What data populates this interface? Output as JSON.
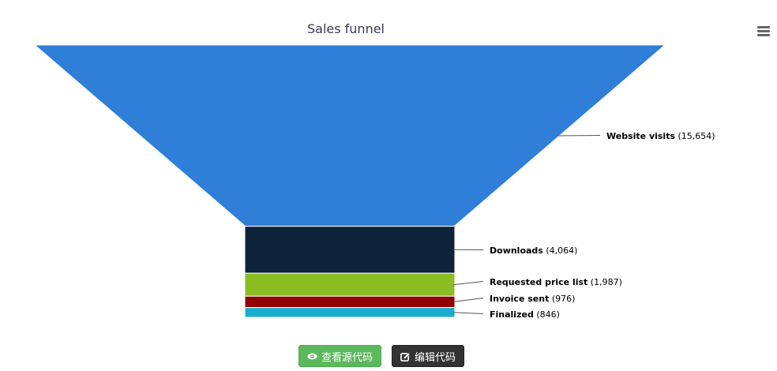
{
  "chart_data": {
    "type": "funnel",
    "title": "Sales funnel",
    "categories": [
      "Website visits",
      "Downloads",
      "Requested price list",
      "Invoice sent",
      "Finalized"
    ],
    "values": [
      15654,
      4064,
      1987,
      976,
      846
    ],
    "value_labels": [
      "(15,654)",
      "(4,064)",
      "(1,987)",
      "(976)",
      "(846)"
    ],
    "colors": [
      "#2f7ed8",
      "#0d233a",
      "#8bbc21",
      "#910000",
      "#1aadce"
    ],
    "legend": "none",
    "data_labels": "right"
  },
  "buttons": {
    "view_source_label": "查看源代码",
    "edit_code_label": "编辑代码"
  },
  "icons": {
    "menu": "hamburger-menu-icon",
    "view_source": "eye-icon",
    "edit_code": "edit-icon"
  }
}
